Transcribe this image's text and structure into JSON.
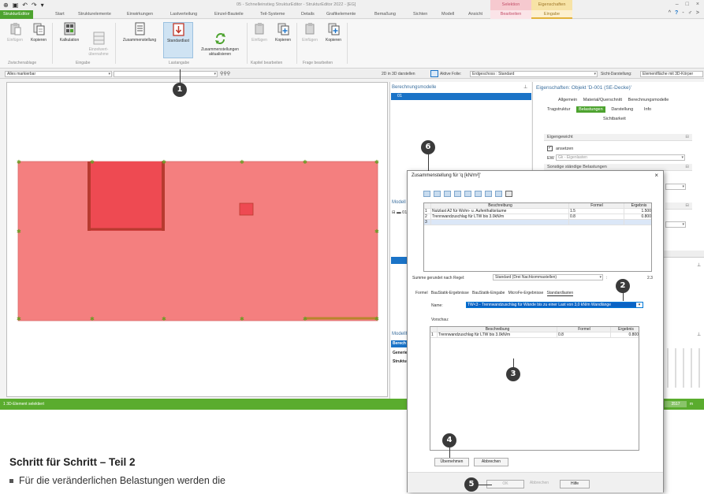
{
  "window": {
    "quick_access": [
      "⊕",
      "▣",
      "↶",
      "↷",
      "▾"
    ],
    "title": "05 - Schnelleinstieg StrukturEditor - StrukturEditor 2022 - [EG]",
    "ctx_selection": "Selektion",
    "ctx_properties": "Eigenschaften",
    "controls": [
      "–",
      "□",
      "×"
    ]
  },
  "tabs": [
    "StrukturEditor",
    "Start",
    "Strukturelemente",
    "Einwirkungen",
    "Lastverteilung",
    "Einzel-Bauteile",
    "Teil-Systeme",
    "Details",
    "Grafikelemente",
    "Bemaßung",
    "Sichten",
    "Modell",
    "Ansicht",
    "Bearbeiten",
    "Eingabe"
  ],
  "help": [
    "^",
    "?",
    "-",
    "♂",
    ">"
  ],
  "ribbon": {
    "buttons": [
      "Einfügen",
      "Kopieren",
      "Kalkulation",
      "Einzelwert-\nübernahme",
      "Zusammenstellung",
      "Standardlast",
      "Zusammenstellungen\naktualisieren",
      "Einfügen",
      "Kopieren",
      "Einfügen",
      "Kopieren"
    ],
    "groups": [
      "Zwischenablage",
      "Eingabe",
      "Lastangabe",
      "Kapitel bearbeiten",
      "Frage bearbeiten"
    ]
  },
  "toolbar": {
    "filter": "Alles markierbar",
    "toggle_2d3d": "2D in 3D darstellen",
    "active_layer_label": "Aktive Folie:",
    "active_layer_value": "Erdgeschoss : Standard",
    "view_label": "Sicht-Darstellung:",
    "view_value": "Elementfläche mit 3D-Körper"
  },
  "status": {
    "text": "1 3D-Element selektiert",
    "value": "3517",
    "unit": "m"
  },
  "middle": {
    "title": "Berechnungsmodelle",
    "selected_item": "01",
    "model_title": "Modell",
    "model_item": "01",
    "hint_title": "Modellhin",
    "hint_rows": [
      "Berech",
      "Generieru",
      "Strukturm"
    ]
  },
  "properties": {
    "title": "Eigenschaften: Objekt 'D-001 (SE-Decke)'",
    "tabs_row1": [
      "Allgemein",
      "Material/Querschnitt",
      "Berechnungsmodelle"
    ],
    "tabs_row2": [
      "Tragstruktur",
      "Belastungen",
      "Darstellung",
      "Info"
    ],
    "tabs_row3": [
      "Sichtbarkeit"
    ],
    "section_eigengewicht": "Eigengewicht",
    "ansetzen": "ansetzen",
    "ew_label": "EW",
    "ew_value": "Gk - Eigenlasten",
    "section_sonstige": "Sonstige ständige Belastungen"
  },
  "dialog": {
    "title": "Zusammenstellung für 'q [kN/m²]'",
    "close": "×",
    "top_table": {
      "headers": [
        "Beschreibung",
        "Formel",
        "Ergebnis"
      ],
      "rows": [
        [
          "1",
          "Nutzlast A2 für Wohn- u. Aufenthaltsräume",
          "1.5",
          "1.500"
        ],
        [
          "2",
          "Trennwandzuschlag für LTW bis 3.0kN/m",
          "0.8",
          "0.800"
        ],
        [
          "3",
          "",
          "",
          ""
        ]
      ]
    },
    "rounding_label": "Summe gerundet nach Regel:",
    "rounding_value": "Standard (Drei Nachkommastellen)",
    "sum_value": "2.3",
    "tabs": [
      "Formel",
      "BauStatik-Ergebnisse",
      "BauStatik-Eingabe",
      "MicroFe-Ergebnisse",
      "Standardlasten"
    ],
    "name_label": "Name:",
    "name_value": "TW<3 - Trennwandzuschlag für Wände bis zu einer Last von 3,0 kN/m Wandlänge",
    "preview_label": "Vorschau:",
    "preview_table": {
      "headers": [
        "Beschreibung",
        "Formel",
        "Ergebnis"
      ],
      "rows": [
        [
          "1",
          "Trennwandzuschlag für LTW bis 3.0kN/m",
          "0.8",
          "0.800"
        ]
      ]
    },
    "apply_button": "Übernehmen",
    "cancel_inner_button": "Abbrechen",
    "ok_button": "OK",
    "cancel_button": "Abbrechen",
    "help_button": "Hilfe"
  },
  "steps": [
    "1",
    "2",
    "3",
    "4",
    "5",
    "6"
  ],
  "text": {
    "heading": "Schritt für Schritt – Teil 2",
    "bullet": "Für die veränderlichen Belastungen werden die"
  },
  "colors": {
    "accent_green": "#4da32f",
    "slab_fill": "#f47f7f",
    "selection_blue": "#1a73c7"
  }
}
